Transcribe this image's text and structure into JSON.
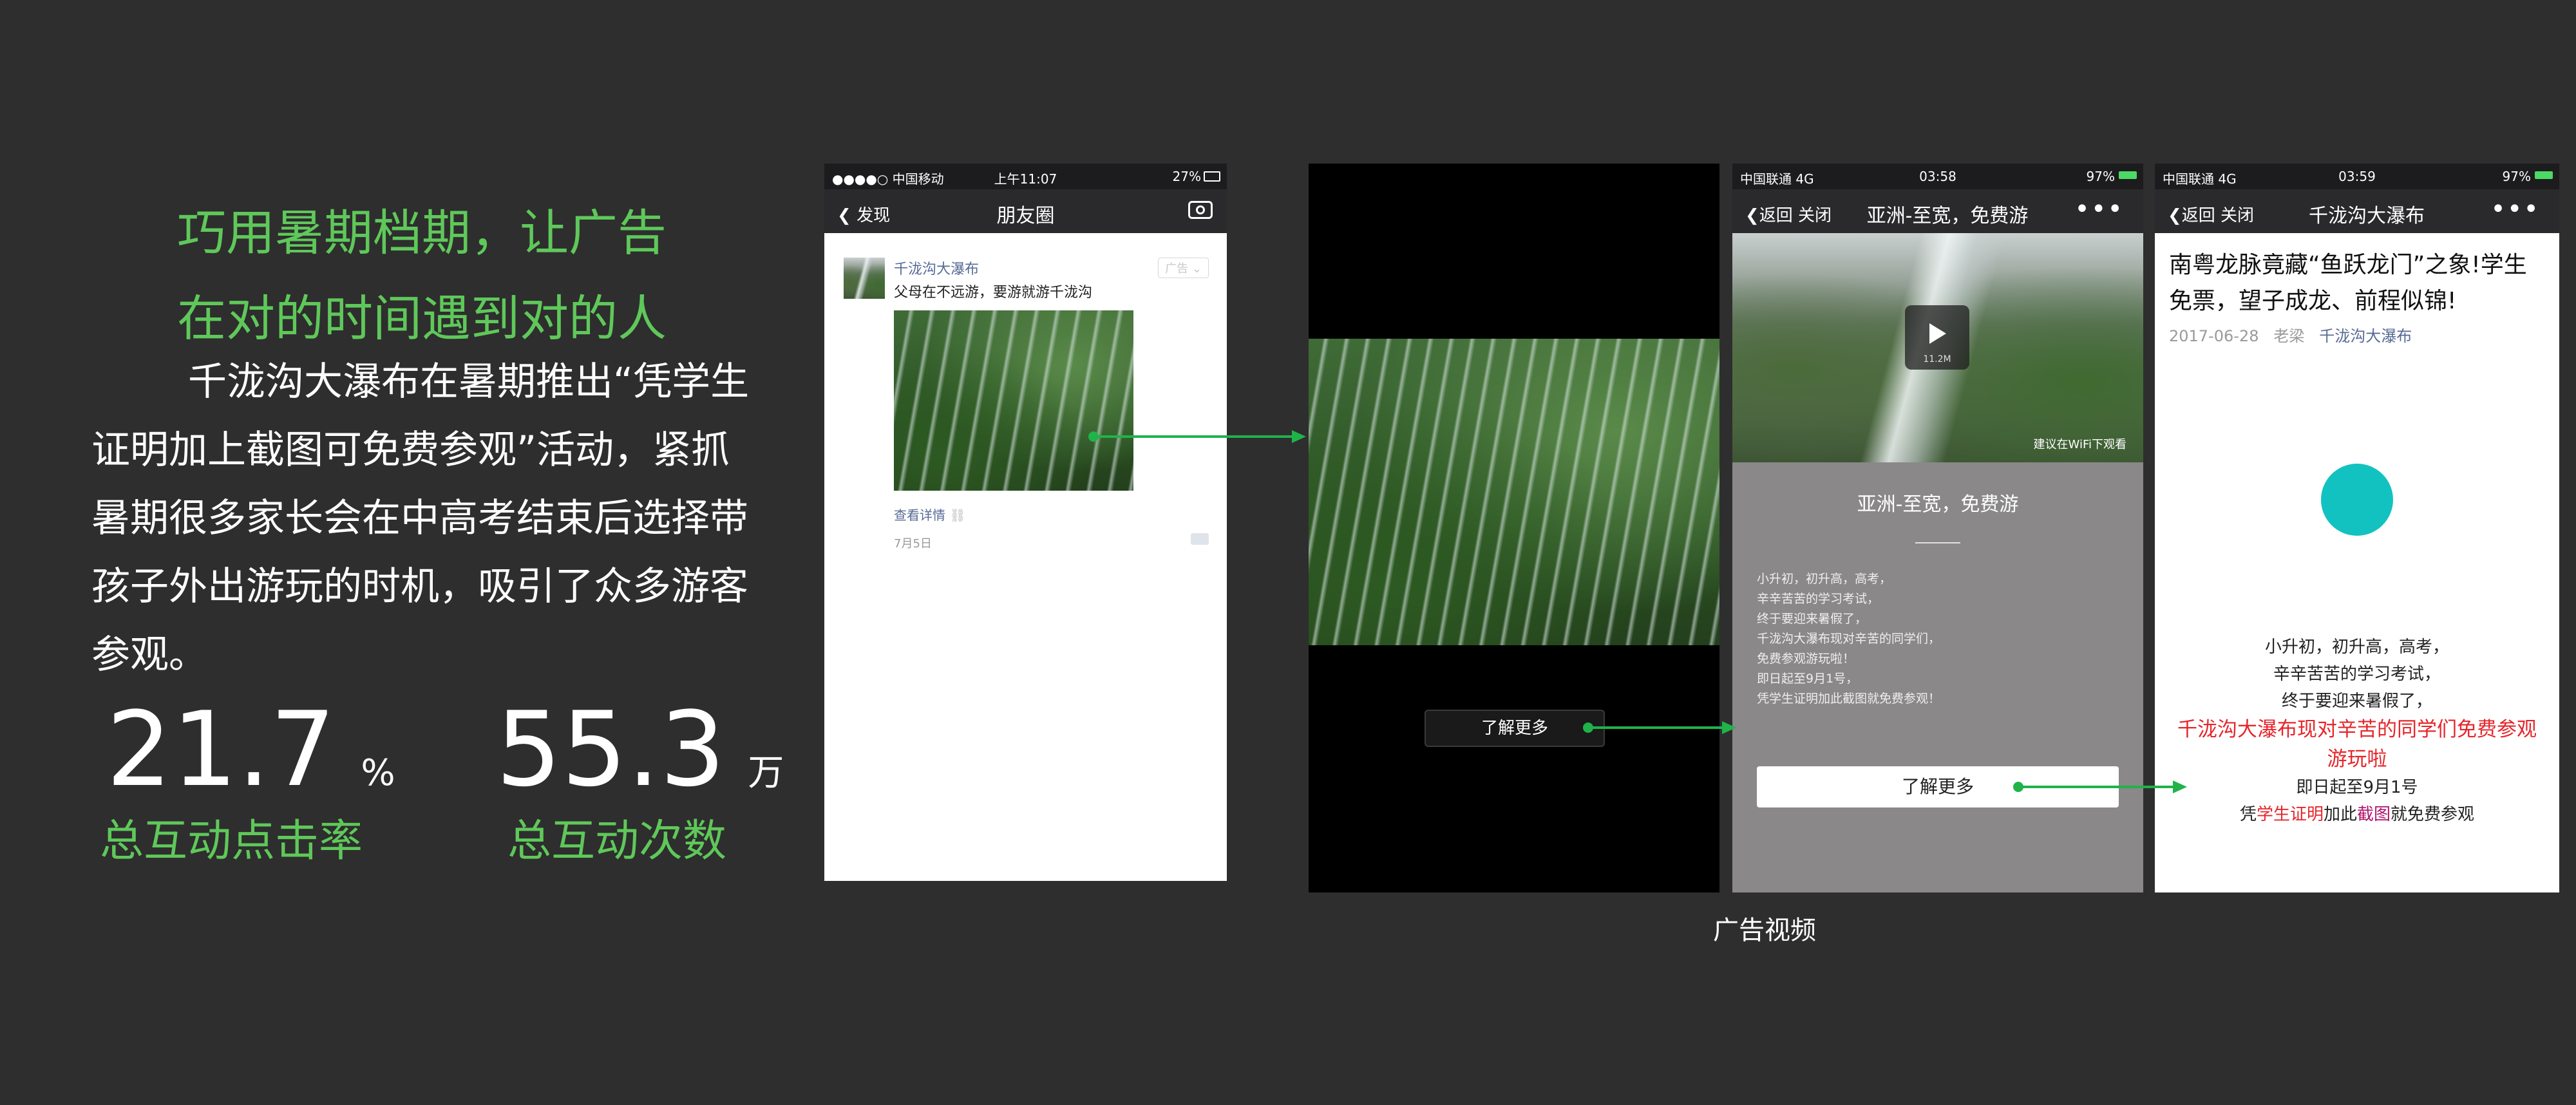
{
  "left": {
    "headline_line1": "巧用暑期档期，让广告",
    "headline_line2": "在对的时间遇到对的人",
    "description": "千泷沟大瀑布在暑期推出“凭学生证明加上截图可免费参观”活动，紧抓暑期很多家长会在中高考结束后选择带孩子外出游玩的时机，吸引了众多游客参观。",
    "stats": [
      {
        "value": "21.7",
        "unit": "%",
        "label": "总互动点击率"
      },
      {
        "value": "55.3",
        "unit": "万",
        "label": "总互动次数"
      }
    ]
  },
  "phone1": {
    "status_left": "●●●●○ 中国移动 ",
    "status_time": "上午11:07",
    "status_right": "27%",
    "back_label": "发现",
    "title": "朋友圈",
    "camera_icon": "camera-icon",
    "post": {
      "author": "千泷沟大瀑布",
      "ad_tag": "广告",
      "text": "父母在不远游，要游就游千泷沟",
      "link_label": "查看详情",
      "date": "7月5日"
    }
  },
  "video": {
    "learn_more": "了解更多"
  },
  "phone3": {
    "status_left": "中国联通  4G",
    "status_time": "03:58",
    "status_right": "97%",
    "back_label": "返回",
    "close_label": "关闭",
    "title": "亚洲-至宽，免费游",
    "more": "•••",
    "video_size": "11.2M",
    "wifi_hint": "建议在WiFi下观看",
    "card_title": "亚洲-至宽，免费游",
    "body_lines": [
      "小升初，初升高，高考，",
      "辛辛苦苦的学习考试，",
      "终于要迎来暑假了，",
      "千泷沟大瀑布现对辛苦的同学们，",
      "免费参观游玩啦！",
      "即日起至9月1号，",
      "凭学生证明加此截图就免费参观！"
    ],
    "button_label": "了解更多"
  },
  "phone4": {
    "status_left": "中国联通  4G",
    "status_time": "03:59",
    "status_right": "97%",
    "back_label": "返回",
    "close_label": "关闭",
    "title": "千泷沟大瀑布",
    "more": "•••",
    "article_title": "南粤龙脉竟藏“鱼跃龙门”之象!学生免票，望子成龙、前程似锦!",
    "article_date": "2017-06-28",
    "article_author": "老梁",
    "article_account": "千泷沟大瀑布",
    "line1": "小升初，初升高，高考，",
    "line2": "辛辛苦苦的学习考试，",
    "line3": "终于要迎来暑假了，",
    "line4": "千泷沟大瀑布现对辛苦的同学们免费参观游玩啦",
    "line5": "即日起至9月1号",
    "line6_a": "凭",
    "line6_b": "学生证明",
    "line6_c": "加此",
    "line6_d": "截图",
    "line6_e": "就免费参观",
    "colors": {
      "red": "#e5262b",
      "purple": "#b0126a",
      "teal": "#12c2c0"
    }
  },
  "caption": "广告视频"
}
